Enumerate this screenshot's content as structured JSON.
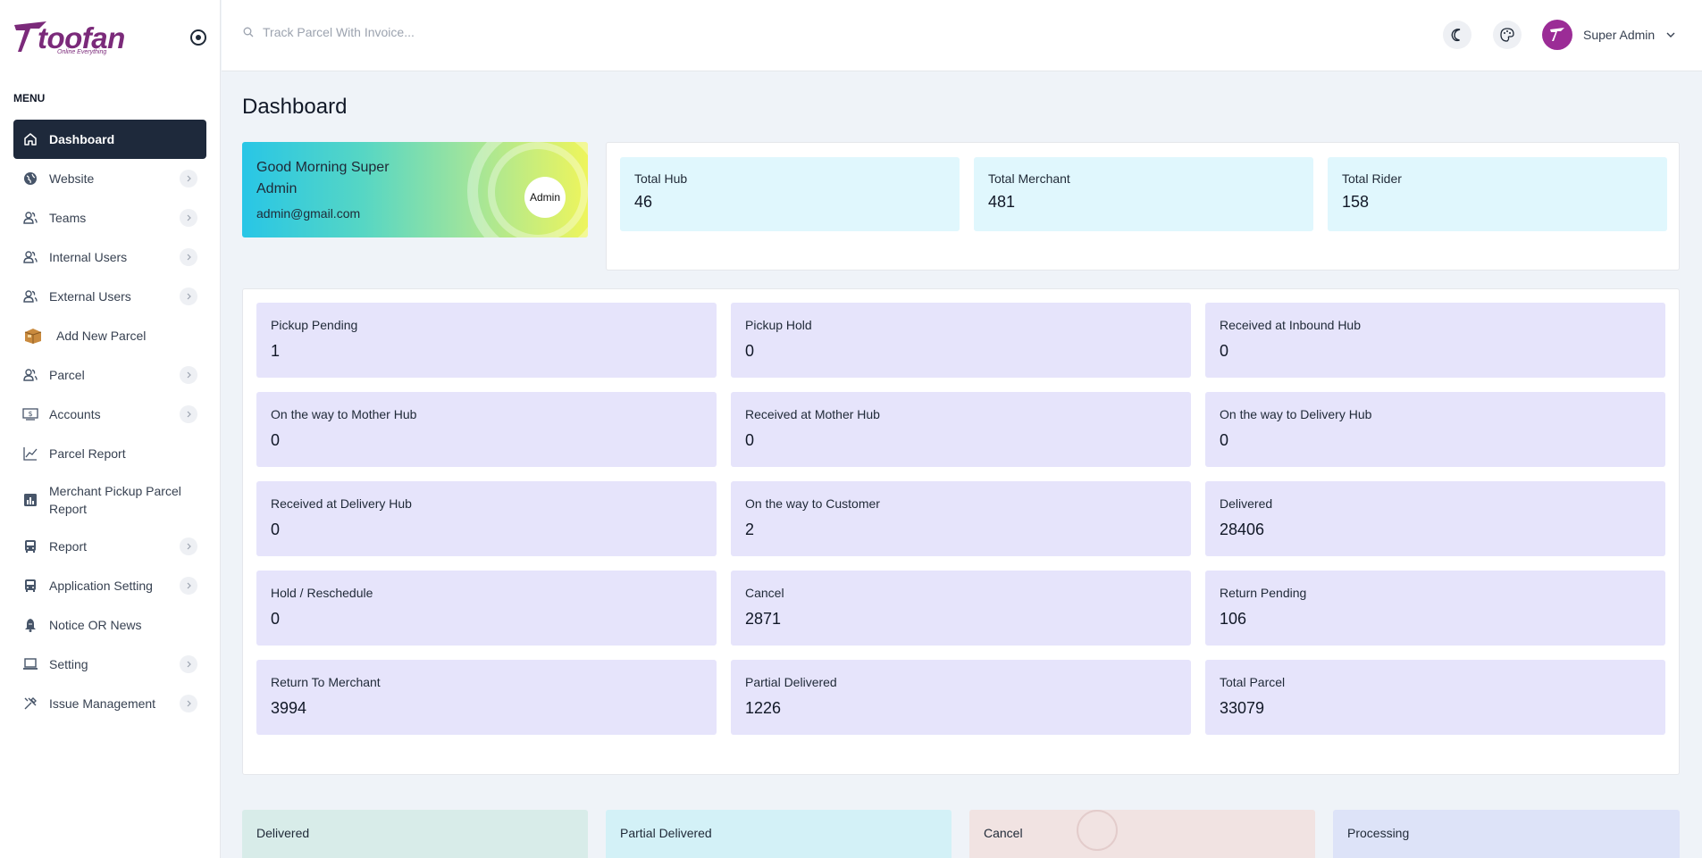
{
  "brand": {
    "name": "toofan",
    "tagline": "Online Everything",
    "accent": "#7b2a7a"
  },
  "sidebar": {
    "menu_title": "MENU",
    "items": [
      {
        "label": "Dashboard",
        "icon": "home-icon",
        "active": true,
        "has_chevron": false
      },
      {
        "label": "Website",
        "icon": "globe-icon",
        "has_chevron": true
      },
      {
        "label": "Teams",
        "icon": "users-icon",
        "has_chevron": true
      },
      {
        "label": "Internal Users",
        "icon": "users-icon",
        "has_chevron": true
      },
      {
        "label": "External Users",
        "icon": "users-icon",
        "has_chevron": true
      },
      {
        "label": "Add New Parcel",
        "icon": "package-icon",
        "has_chevron": false
      },
      {
        "label": "Parcel",
        "icon": "users-icon",
        "has_chevron": true
      },
      {
        "label": "Accounts",
        "icon": "money-icon",
        "has_chevron": true
      },
      {
        "label": "Parcel Report",
        "icon": "line-chart-icon",
        "has_chevron": false
      },
      {
        "label": "Merchant Pickup Parcel Report",
        "icon": "bar-chart-icon",
        "has_chevron": false
      },
      {
        "label": "Report",
        "icon": "bus-icon",
        "has_chevron": true
      },
      {
        "label": "Application Setting",
        "icon": "bus-icon",
        "has_chevron": true
      },
      {
        "label": "Notice OR News",
        "icon": "bell-icon",
        "has_chevron": false
      },
      {
        "label": "Setting",
        "icon": "laptop-icon",
        "has_chevron": true
      },
      {
        "label": "Issue Management",
        "icon": "tools-icon",
        "has_chevron": true
      }
    ]
  },
  "header": {
    "search_placeholder": "Track Parcel With Invoice...",
    "user_name": "Super Admin"
  },
  "main": {
    "page_title": "Dashboard",
    "welcome": {
      "greeting": "Good Morning Super Admin",
      "email": "admin@gmail.com",
      "role": "Admin"
    },
    "totals": [
      {
        "label": "Total Hub",
        "value": "46"
      },
      {
        "label": "Total Merchant",
        "value": "481"
      },
      {
        "label": "Total Rider",
        "value": "158"
      }
    ],
    "statuses": [
      {
        "label": "Pickup Pending",
        "value": "1"
      },
      {
        "label": "Pickup Hold",
        "value": "0"
      },
      {
        "label": "Received at Inbound Hub",
        "value": "0"
      },
      {
        "label": "On the way to Mother Hub",
        "value": "0"
      },
      {
        "label": "Received at Mother Hub",
        "value": "0"
      },
      {
        "label": "On the way to Delivery Hub",
        "value": "0"
      },
      {
        "label": "Received at Delivery Hub",
        "value": "0"
      },
      {
        "label": "On the way to Customer",
        "value": "2"
      },
      {
        "label": "Delivered",
        "value": "28406"
      },
      {
        "label": "Hold / Reschedule",
        "value": "0"
      },
      {
        "label": "Cancel",
        "value": "2871"
      },
      {
        "label": "Return Pending",
        "value": "106"
      },
      {
        "label": "Return To Merchant",
        "value": "3994"
      },
      {
        "label": "Partial Delivered",
        "value": "1226"
      },
      {
        "label": "Total Parcel",
        "value": "33079"
      }
    ],
    "bottom_cards": [
      {
        "label": "Delivered",
        "color": "#d8ece9"
      },
      {
        "label": "Partial Delivered",
        "color": "#d3f1f7"
      },
      {
        "label": "Cancel",
        "color": "#f1e3e2"
      },
      {
        "label": "Processing",
        "color": "#dde3f8"
      }
    ]
  }
}
